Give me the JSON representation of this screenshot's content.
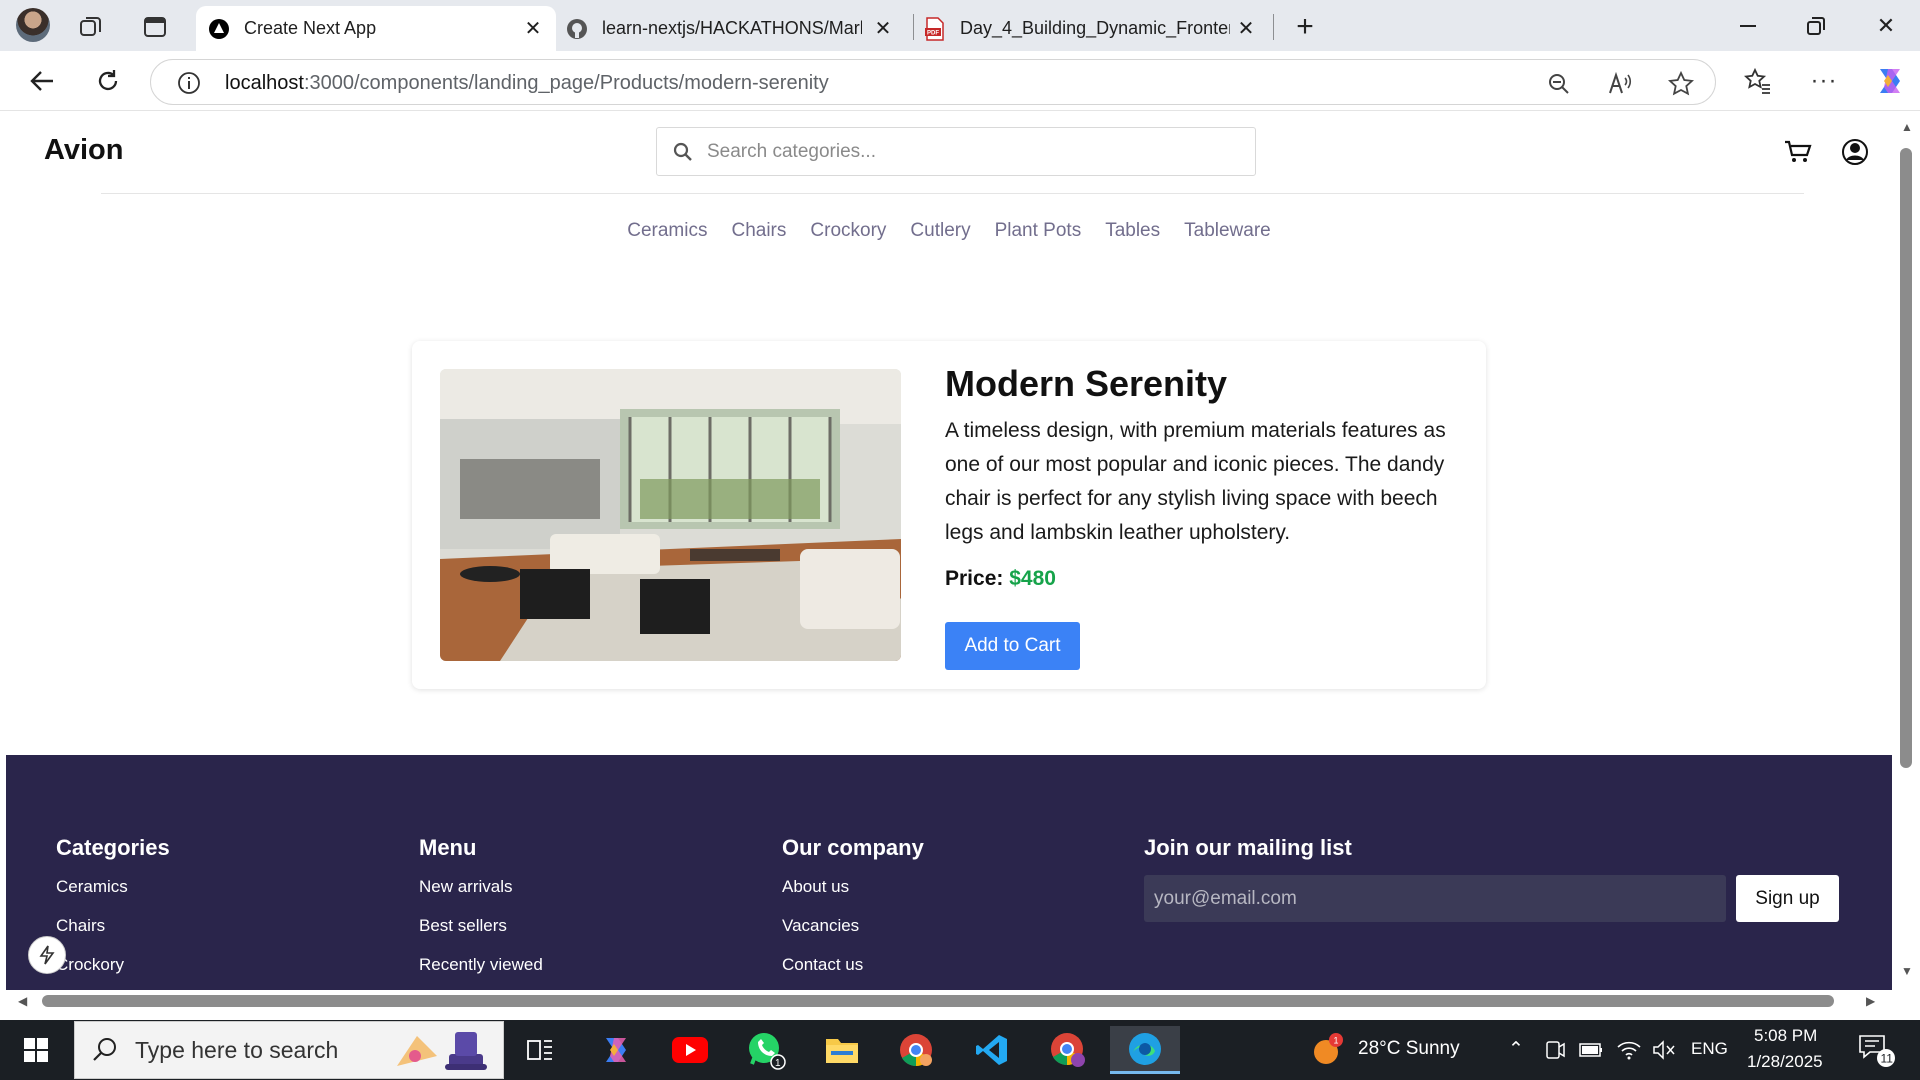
{
  "browser": {
    "tabs": [
      {
        "title": "Create Next App",
        "active": true
      },
      {
        "title": "learn-nextjs/HACKATHONS/Mark",
        "active": false
      },
      {
        "title": "Day_4_Building_Dynamic_Fronten",
        "active": false
      }
    ],
    "url_host": "localhost",
    "url_path": ":3000/components/landing_page/Products/modern-serenity"
  },
  "site": {
    "brand": "Avion",
    "search_placeholder": "Search categories...",
    "categories": [
      "Ceramics",
      "Chairs",
      "Crockory",
      "Cutlery",
      "Plant Pots",
      "Tables",
      "Tableware"
    ]
  },
  "product": {
    "title": "Modern Serenity",
    "description": "A timeless design, with premium materials features as one of our most popular and iconic pieces. The dandy chair is perfect for any stylish living space with beech legs and lambskin leather upholstery.",
    "price_label": "Price:",
    "price_value": "$480",
    "add_to_cart": "Add to Cart"
  },
  "footer": {
    "categories_heading": "Categories",
    "categories": [
      "Ceramics",
      "Chairs",
      "Crockory"
    ],
    "menu_heading": "Menu",
    "menu": [
      "New arrivals",
      "Best sellers",
      "Recently viewed"
    ],
    "company_heading": "Our company",
    "company": [
      "About us",
      "Vacancies",
      "Contact us"
    ],
    "mailing_heading": "Join our mailing list",
    "email_placeholder": "your@email.com",
    "signup_label": "Sign up"
  },
  "taskbar": {
    "search_placeholder": "Type here to search",
    "weather": "28°C  Sunny",
    "weather_badge": "1",
    "language": "ENG",
    "time": "5:08 PM",
    "date": "1/28/2025",
    "notification_count": "11",
    "whatsapp_badge": "1"
  }
}
